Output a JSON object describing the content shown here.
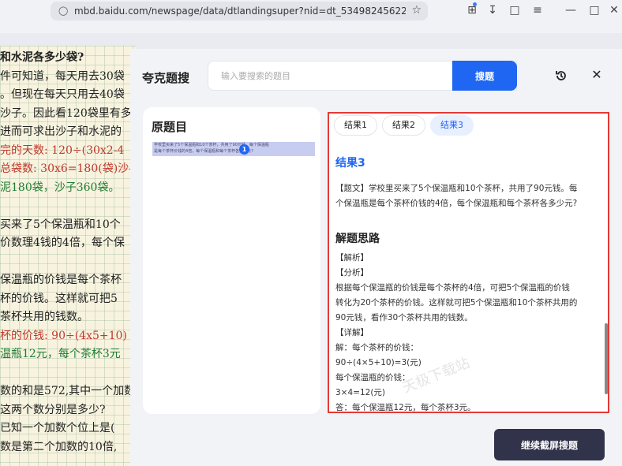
{
  "browser": {
    "url": "mbd.baidu.com/newspage/data/dtlandingsuper?nid=dt_534982456220920..."
  },
  "notebook": {
    "lines": [
      {
        "text": "和水泥各多少袋?",
        "cls": "bold"
      },
      {
        "text": "件可知道，每天用去30袋",
        "cls": ""
      },
      {
        "text": "。但现在每天只用去40袋",
        "cls": ""
      },
      {
        "text": "沙子。因此看120袋里有多",
        "cls": ""
      },
      {
        "text": "进而可求出沙子和水泥的",
        "cls": ""
      },
      {
        "text": "完的天数: 120÷(30x2-4",
        "cls": "red"
      },
      {
        "text": "总袋数: 30x6=180(袋)沙-",
        "cls": "red"
      },
      {
        "text": "泥180袋，沙子360袋。",
        "cls": "green"
      },
      {
        "text": "",
        "cls": ""
      },
      {
        "text": "买来了5个保温瓶和10个",
        "cls": ""
      },
      {
        "text": "价数理4钱的4倍，每个保",
        "cls": ""
      },
      {
        "text": "",
        "cls": ""
      },
      {
        "text": "保温瓶的价钱是每个茶杯",
        "cls": ""
      },
      {
        "text": "杯的价钱。这样就可把5",
        "cls": ""
      },
      {
        "text": "茶杯共用的钱数。",
        "cls": ""
      },
      {
        "text": "杯的价钱: 90÷(4x5+10)",
        "cls": "red"
      },
      {
        "text": "温瓶12元，每个茶杯3元",
        "cls": "green"
      },
      {
        "text": "",
        "cls": ""
      },
      {
        "text": "数的和是572,其中一个加数",
        "cls": ""
      },
      {
        "text": "这两个数分别是多少?",
        "cls": ""
      },
      {
        "text": "已知一个加数个位上是(",
        "cls": ""
      },
      {
        "text": "数是第二个加数的10倍,",
        "cls": ""
      }
    ]
  },
  "panel": {
    "brand": "夸克题搜",
    "search_placeholder": "输入要搜索的题目",
    "search_button": "搜题",
    "original_title": "原题目",
    "original_thumb_line1": "学校里买来了5个保温瓶和10个茶杯，共用了90元钱。每个保温瓶",
    "original_thumb_line2": "是每个茶杯价钱的4倍，每个保温瓶和每个茶杯各多少元?",
    "original_badge": "1",
    "tabs": [
      "结果1",
      "结果2",
      "结果3"
    ],
    "active_tab": "结果3",
    "result_title": "结果3",
    "question_text_1": "【题文】学校里买来了5个保温瓶和10个茶杯，共用了90元钱。每",
    "question_text_2": "个保温瓶是每个茶杯价钱的4倍，每个保温瓶和每个茶杯各多少元?",
    "section_title": "解题思路",
    "analysis": [
      "【解析】",
      "【分析】",
      "根据每个保温瓶的价钱是每个茶杯的4倍，可把5个保温瓶的价钱",
      "转化为20个茶杯的价钱。这样就可把5个保温瓶和10个茶杯共用的",
      "90元钱，看作30个茶杯共用的钱数。",
      "【详解】",
      "解：每个茶杯的价钱：",
      "90÷(4×5+10)=3(元)",
      "每个保温瓶的价钱：",
      "3×4=12(元)",
      "答：每个保温瓶12元，每个茶杯3元。"
    ],
    "watermark": "天极下载站",
    "continue_button": "继续截屏搜题"
  }
}
